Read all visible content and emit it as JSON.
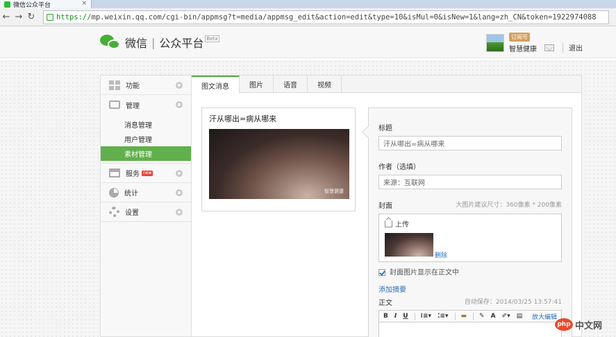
{
  "browser": {
    "tab_title": "微信公众平台",
    "url_protocol": "https://",
    "url_rest": "mp.weixin.qq.com/cgi-bin/appmsg?t=media/appmsg_edit&action=edit&type=10&isMul=0&isNew=1&lang=zh_CN&token=1922974088"
  },
  "header": {
    "logo_text": "微信",
    "logo_sub": "公众平台",
    "beta": "Beta",
    "account_badge": "订阅号",
    "account_name": "智慧健康",
    "logout": "退出"
  },
  "sidebar": {
    "items": [
      {
        "label": "功能"
      },
      {
        "label": "管理"
      },
      {
        "label": "服务",
        "badge": "new"
      },
      {
        "label": "统计"
      },
      {
        "label": "设置"
      }
    ],
    "sub": [
      {
        "label": "消息管理"
      },
      {
        "label": "用户管理"
      },
      {
        "label": "素材管理"
      }
    ]
  },
  "tabs": [
    {
      "label": "图文消息"
    },
    {
      "label": "图片"
    },
    {
      "label": "语音"
    },
    {
      "label": "视频"
    }
  ],
  "preview": {
    "title": "汗从哪出=病从哪来",
    "image_mark": "智慧健康"
  },
  "editor": {
    "title_label": "标题",
    "title_value": "汗从哪出=病从哪来",
    "author_label": "作者（选填）",
    "author_value": "来源：互联网",
    "cover_label": "封面",
    "cover_hint": "大图片建议尺寸：360像素 * 200像素",
    "upload": "上传",
    "delete": "删除",
    "show_cover": "封面图片显示在正文中",
    "add_summary": "添加摘要",
    "body_label": "正文",
    "autosave": "自动保存：2014/03/25 13:57:41",
    "toolbar": {
      "bold": "B",
      "italic": "I",
      "underline": "U",
      "font": "A",
      "expand": "放大编辑"
    }
  },
  "watermark": {
    "php": "php",
    "text": "中文网"
  }
}
